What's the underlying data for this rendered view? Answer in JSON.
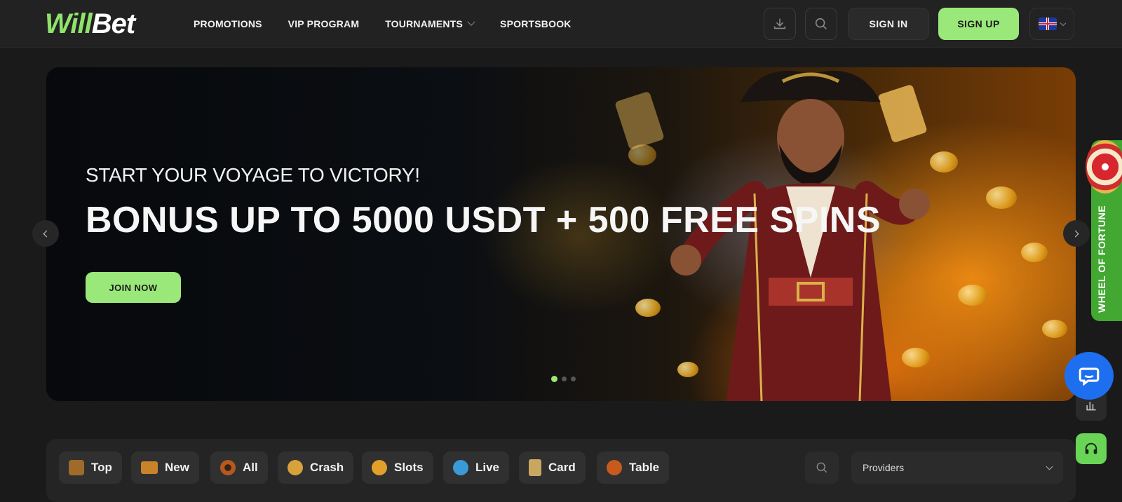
{
  "brand": {
    "logo_part1": "Will",
    "logo_part2": "Bet",
    "accent": "#9ae87a"
  },
  "nav": {
    "items": [
      {
        "label": "PROMOTIONS"
      },
      {
        "label": "VIP PROGRAM"
      },
      {
        "label": "TOURNAMENTS",
        "has_dropdown": true
      },
      {
        "label": "SPORTSBOOK"
      }
    ]
  },
  "header": {
    "download_icon": "download-icon",
    "search_icon": "search-icon",
    "sign_in": "SIGN IN",
    "sign_up": "SIGN UP",
    "language_icon": "uk-flag-icon"
  },
  "hero": {
    "subtitle": "START YOUR VOYAGE TO VICTORY!",
    "title": "BONUS UP TO 5000 USDT + 500 FREE SPINS",
    "cta": "JOIN NOW",
    "slides_total": 3,
    "active_slide": 1
  },
  "side": {
    "wheel_label": "WHEEL OF FORTUNE",
    "chat_icon": "chat-icon",
    "stats_icon": "bar-chart-icon",
    "support_icon": "headset-icon"
  },
  "categories": [
    {
      "label": "Top",
      "icon": "treasure-chest-icon",
      "color": "#a06a2a"
    },
    {
      "label": "New",
      "icon": "ticket-icon",
      "color": "#c8822a"
    },
    {
      "label": "All",
      "icon": "roulette-icon",
      "color": "#b45a1e"
    },
    {
      "label": "Crash",
      "icon": "crash-icon",
      "color": "#d8a23a"
    },
    {
      "label": "Slots",
      "icon": "slots-icon",
      "color": "#e2a02a"
    },
    {
      "label": "Live",
      "icon": "live-dealer-icon",
      "color": "#3a9ad8"
    },
    {
      "label": "Card",
      "icon": "card-icon",
      "color": "#c8a860"
    },
    {
      "label": "Table",
      "icon": "table-game-icon",
      "color": "#c85a1e"
    }
  ],
  "filters": {
    "search_icon": "search-icon",
    "providers_label": "Providers"
  }
}
